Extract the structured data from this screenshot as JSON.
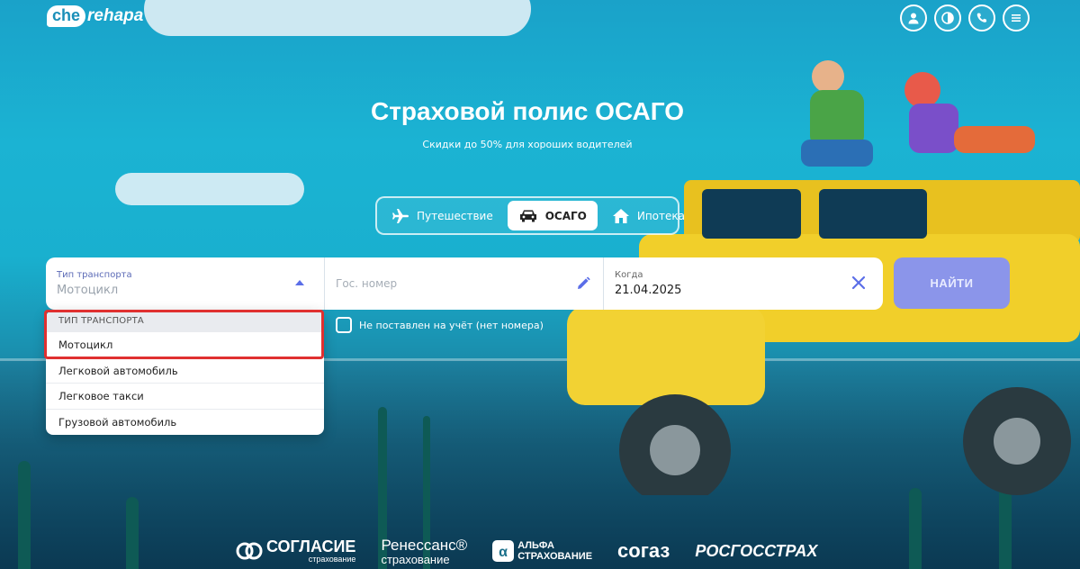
{
  "logo": {
    "bubble": "che",
    "text": "rehapa"
  },
  "header": {
    "icons": [
      "user-icon",
      "contrast-icon",
      "phone-icon",
      "menu-icon"
    ]
  },
  "hero": {
    "title": "Страховой полис ОСАГО",
    "subtitle": "Скидки до 50% для хороших водителей"
  },
  "tabs": [
    {
      "label": "Путешествие",
      "icon": "airplane-icon",
      "active": false
    },
    {
      "label": "ОСАГО",
      "icon": "car-icon",
      "active": true
    },
    {
      "label": "Ипотека",
      "icon": "house-icon",
      "active": false
    }
  ],
  "form": {
    "vehicle_type": {
      "label": "Тип транспорта",
      "value": "Мотоцикл"
    },
    "plate": {
      "placeholder": "Гос. номер"
    },
    "date": {
      "label": "Когда",
      "value": "21.04.2025"
    },
    "search_label": "НАЙТИ"
  },
  "not_registered_label": "Не поставлен на учёт (нет номера)",
  "dropdown": {
    "header": "ТИП ТРАНСПОРТА",
    "options": [
      "Мотоцикл",
      "Легковой автомобиль",
      "Легковое такси",
      "Грузовой автомобиль"
    ]
  },
  "partners": [
    {
      "name": "СОГЛАСИЕ",
      "sub": "страхование"
    },
    {
      "name": "Ренессанс®",
      "sub": "страхование"
    },
    {
      "name": "АЛЬФА",
      "sub": "СТРАХОВАНИЕ"
    },
    {
      "name": "согаз",
      "sub": ""
    },
    {
      "name": "РОСГОССТРАХ",
      "sub": ""
    }
  ],
  "colors": {
    "accent": "#5b6ee8",
    "search_button": "#8b95ea",
    "highlight": "#e03030"
  }
}
